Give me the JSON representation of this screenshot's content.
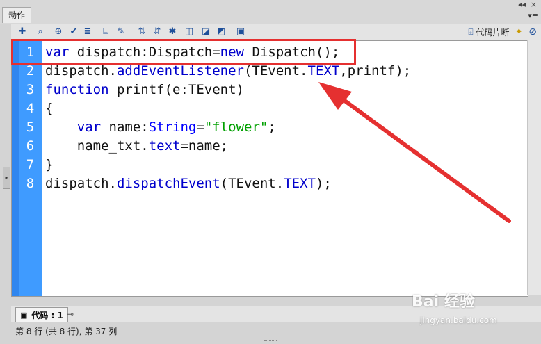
{
  "panel": {
    "tab_label": "动作",
    "collapse_glyph": "◂◂",
    "close_glyph": "×",
    "menu_glyph": "▾≡"
  },
  "toolbar": {
    "icons": [
      "add-statement-icon",
      "find-icon",
      "target-icon",
      "check-syntax-icon",
      "auto-format-icon",
      "show-code-hint-icon",
      "debug-options-icon",
      "collapse-between-braces-icon",
      "collapse-selection-icon",
      "expand-all-icon",
      "apply-block-comment-icon",
      "apply-line-comment-icon",
      "remove-comment-icon",
      "show-hide-toolbox-icon"
    ],
    "snippets_label": "代码片断"
  },
  "code": {
    "line_numbers": [
      "1",
      "2",
      "3",
      "4",
      "5",
      "6",
      "7",
      "8"
    ],
    "line1": {
      "kw": "var",
      "rest": " dispatch:Dispatch=",
      "kw2": "new",
      "rest2": " Dispatch();"
    },
    "line2": {
      "a": "dispatch.",
      "b": "addEventListener",
      "c": "(TEvent.",
      "d": "TEXT",
      "e": ",printf);"
    },
    "line3": {
      "kw": "function",
      "rest": " printf(e:TEvent)"
    },
    "line4": {
      "text": "{"
    },
    "line5": {
      "indent": "    ",
      "kw": "var",
      "rest": " name:",
      "ty": "String",
      "eq": "=",
      "str": "\"flower\"",
      "end": ";"
    },
    "line6": {
      "indent": "    ",
      "a": "name_txt.",
      "b": "text",
      "c": "=name;"
    },
    "line7": {
      "text": "}"
    },
    "line8": {
      "a": "dispatch.",
      "b": "dispatchEvent",
      "c": "(TEvent.",
      "d": "TEXT",
      "e": ");"
    }
  },
  "bottom": {
    "tab_label": "代码 : 1",
    "status": "第 8 行 (共 8 行), 第 37 列"
  },
  "watermark": {
    "logo": "Bai 经验",
    "url": "jingyan.baidu.com"
  },
  "colors": {
    "gutter": "#3f9bff",
    "keyword": "#0000cc",
    "string": "#00a000",
    "annotation": "#e53030"
  }
}
